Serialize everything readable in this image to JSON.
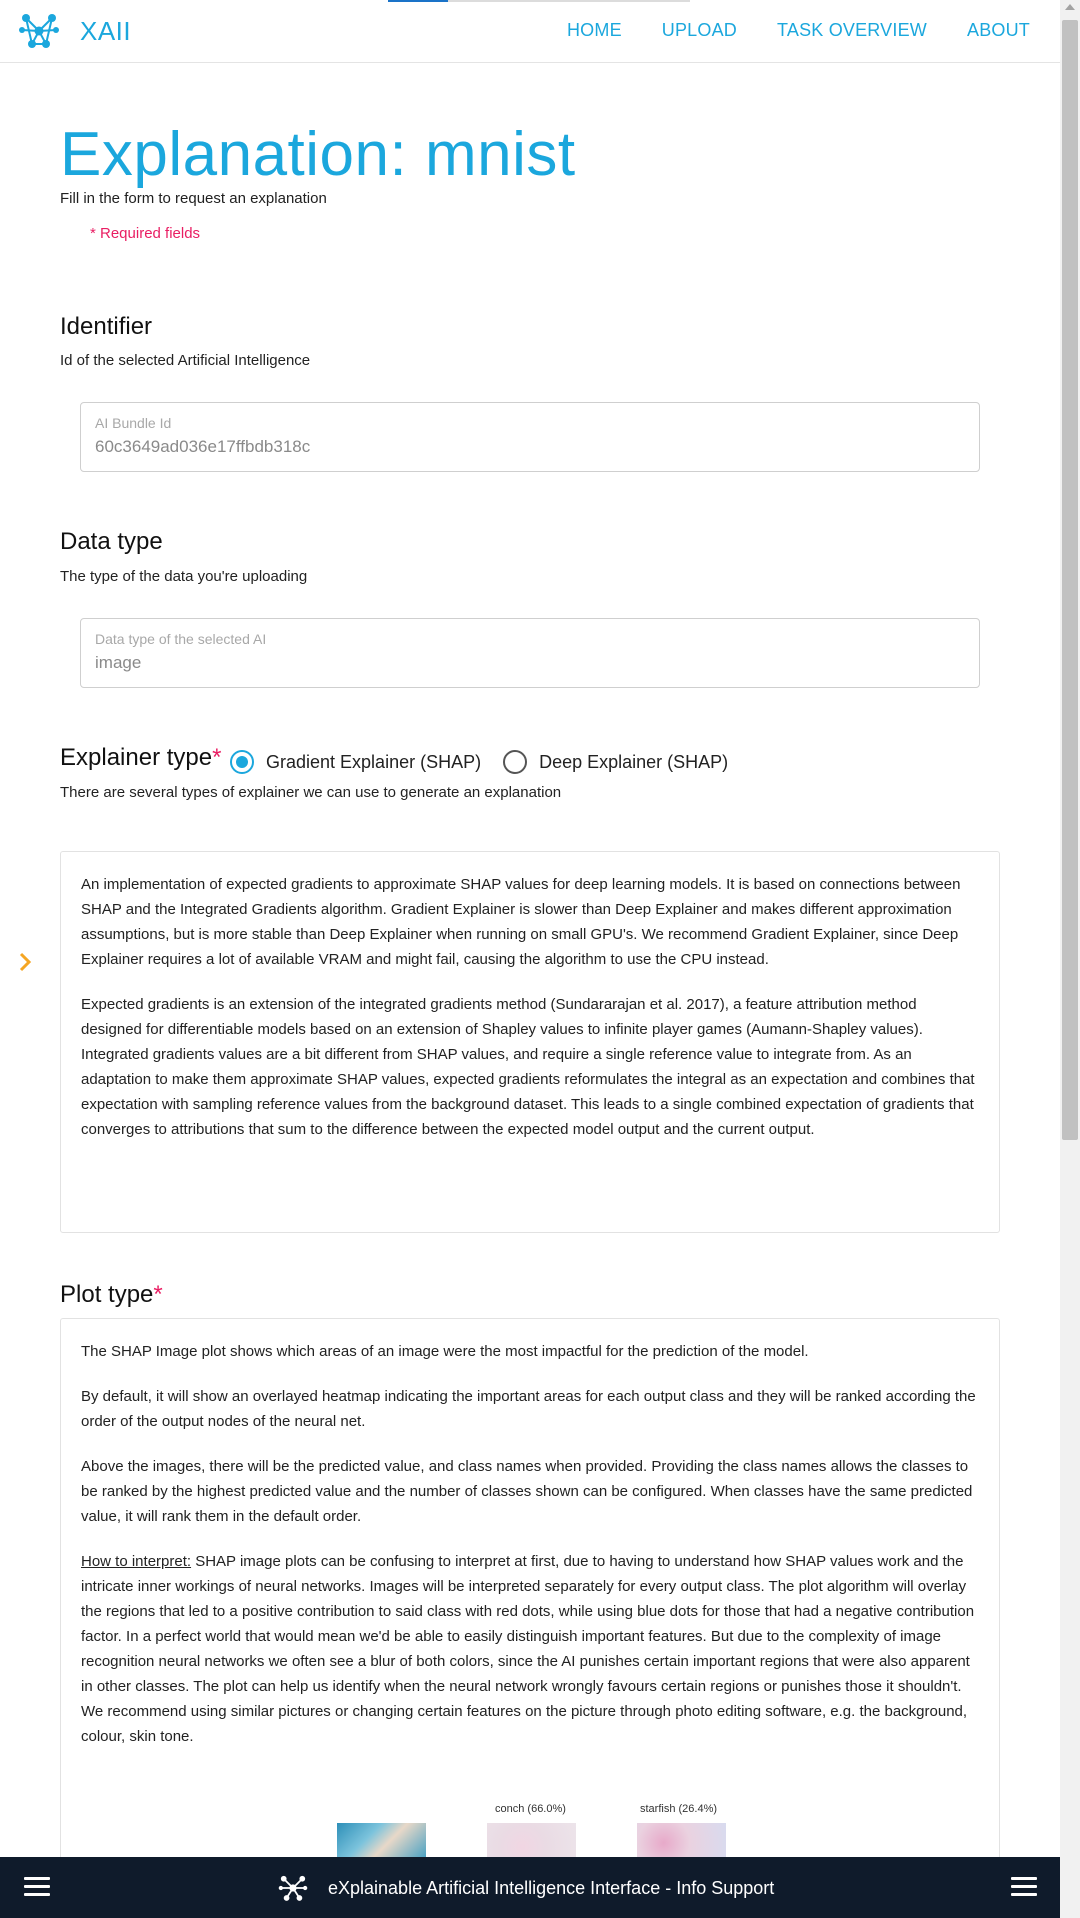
{
  "header": {
    "brand": "XAII",
    "nav": [
      "HOME",
      "UPLOAD",
      "TASK OVERVIEW",
      "ABOUT"
    ]
  },
  "page": {
    "title": "Explanation: mnist",
    "subtitle": "Fill in the form to request an explanation",
    "required_note": "* Required fields"
  },
  "identifier": {
    "title": "Identifier",
    "desc": "Id of the selected Artificial Intelligence",
    "field_label": "AI Bundle Id",
    "field_value": "60c3649ad036e17ffbdb318c"
  },
  "data_type": {
    "title": "Data type",
    "desc": "The type of the data you're uploading",
    "field_label": "Data type of the selected AI",
    "field_value": "image"
  },
  "explainer": {
    "title": "Explainer type",
    "required_mark": "*",
    "desc": "There are several types of explainer we can use to generate an explanation",
    "options": [
      "Gradient Explainer (SHAP)",
      "Deep Explainer (SHAP)"
    ],
    "selected": "Gradient Explainer (SHAP)",
    "paragraphs": [
      "An implementation of expected gradients to approximate SHAP values for deep learning models. It is based on connections between SHAP and the Integrated Gradients algorithm. Gradient Explainer is slower than Deep Explainer and makes different approximation assumptions, but is more stable than Deep Explainer when running on small GPU's. We recommend Gradient Explainer, since Deep Explainer requires a lot of available VRAM and might fail, causing the algorithm to use the CPU instead.",
      "Expected gradients is an extension of the integrated gradients method (Sundararajan et al. 2017), a feature attribution method designed for differentiable models based on an extension of Shapley values to infinite player games (Aumann-Shapley values). Integrated gradients values are a bit different from SHAP values, and require a single reference value to integrate from. As an adaptation to make them approximate SHAP values, expected gradients reformulates the integral as an expectation and combines that expectation with sampling reference values from the background dataset. This leads to a single combined expectation of gradients that converges to attributions that sum to the difference between the expected model output and the current output."
    ]
  },
  "plot": {
    "title": "Plot type",
    "required_mark": "*",
    "paragraphs": [
      "The SHAP Image plot shows which areas of an image were the most impactful for the prediction of the model.",
      "By default, it will show an overlayed heatmap indicating the important areas for each output class and they will be ranked according the order of the output nodes of the neural net.",
      "Above the images, there will be the predicted value, and class names when provided. Providing the class names allows the classes to be ranked by the highest predicted value and the number of classes shown can be configured. When classes have the same predicted value, it will rank them in the default order."
    ],
    "interpret_label": "How to interpret:",
    "interpret_text": " SHAP image plots can be confusing to interpret at first, due to having to understand how SHAP values work and the intricate inner workings of neural networks. Images will be interpreted separately for every output class. The plot algorithm will overlay the regions that led to a positive contribution to said class with red dots, while using blue dots for those that had a negative contribution factor. In a perfect world that would mean we'd be able to easily distinguish important features. But due to the complexity of image recognition neural networks we often see a blur of both colors, since the AI punishes certain important regions that were also apparent in other classes. The plot can help us identify when the neural network wrongly favours certain regions or punishes those it shouldn't. We recommend using similar pictures or changing certain features on the picture through photo editing software, e.g. the background, colour, skin tone.",
    "example_captions": [
      "conch (66.0%)",
      "starfish (26.4%)"
    ]
  },
  "footer": {
    "text": "eXplainable Artificial Intelligence Interface - Info Support"
  },
  "colors": {
    "accent": "#1ba7dd",
    "required": "#e91e63",
    "footer_bg": "#0f1b2b",
    "chevron": "#f5a623"
  }
}
